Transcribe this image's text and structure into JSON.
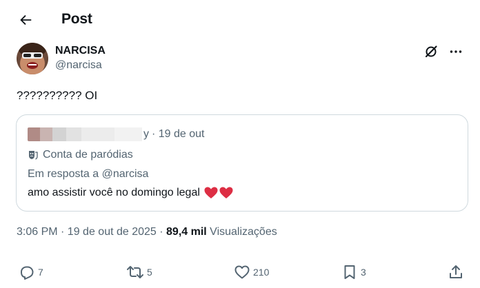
{
  "header": {
    "title": "Post"
  },
  "author": {
    "display_name": "NARCISA",
    "handle": "@narcisa"
  },
  "post": {
    "text": "?????????? OI"
  },
  "quote": {
    "name_suffix": "y",
    "date": "· 19 de out",
    "label": "Conta de paródias",
    "reply_to": "Em resposta a @narcisa",
    "text": "amo assistir você no domingo legal"
  },
  "meta": {
    "time_date": "3:06 PM · 19 de out de 2025 · ",
    "views_count": "89,4 mil",
    "views_label": " Visualizações"
  },
  "actions": {
    "replies": "7",
    "reposts": "5",
    "likes": "210",
    "bookmarks": "3"
  },
  "colors": {
    "text": "#0f1419",
    "secondary": "#536471",
    "border": "#cfd9de",
    "heart": "#e0245e"
  }
}
